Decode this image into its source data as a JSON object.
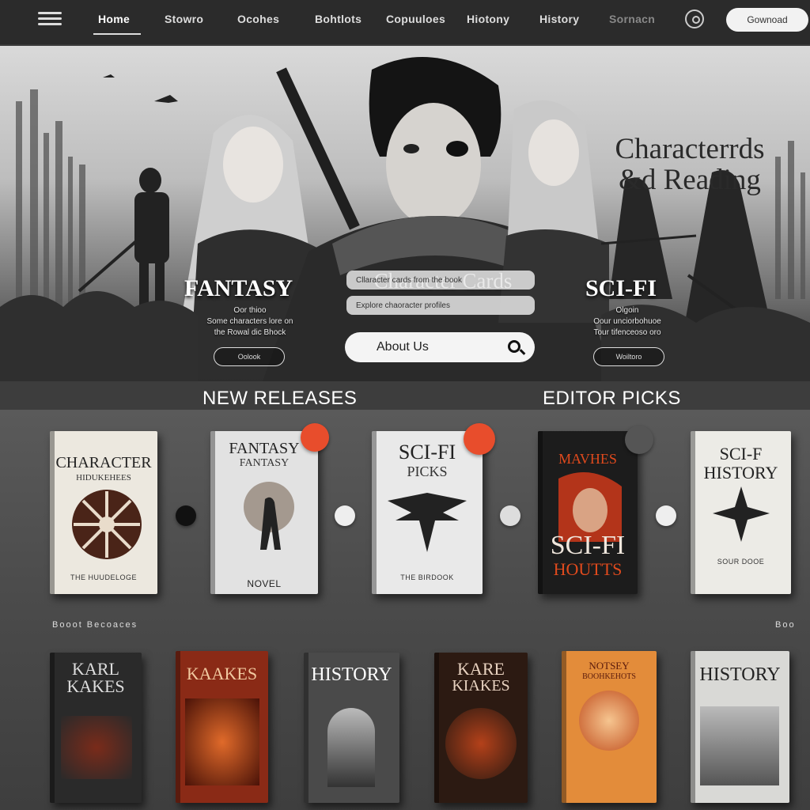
{
  "nav": {
    "items": [
      "Home",
      "Stowro",
      "Ocohes",
      "Bohtlots",
      "Copuuloes",
      "Hiotony",
      "History",
      "Sornacn"
    ],
    "download_label": "Gownoad"
  },
  "hero": {
    "title_line1": "Characterrds",
    "title_line2": "&d Reading",
    "card_title": "Character Cards",
    "pill1": "Cllaracter cards from the book",
    "pill2": "Explore chaoracter profiles",
    "search_text": "About Us",
    "left_genre": "FANTASY",
    "left_desc": "Oor thioo\nSome characters lore on\nthe Rowal dic Bhock",
    "left_btn": "Oolook",
    "right_genre": "SCI-FI",
    "right_desc": "Olgoin\nOour unciorbohuoe\nTour tifenceoso oro",
    "right_btn": "Woiltoro"
  },
  "sections": {
    "left": "NEW RELEASES",
    "right": "EDITOR PICKS",
    "row2_label": "Booot Becoaces",
    "row2_right": "Boo"
  },
  "row1": [
    {
      "title": "CHARACTER",
      "subtitle": "HIDUKEHEES",
      "footer": "THE HUUDELOGE",
      "bg": "#ece8df",
      "fg": "#222"
    },
    {
      "title": "FANTASY",
      "subtitle": "FANTASY",
      "footer": "NOVEL",
      "bg": "#e2e2e2",
      "fg": "#222"
    },
    {
      "title": "SCI-FI",
      "subtitle": "PICKS",
      "footer": "THE BIRDOOK",
      "bg": "#e9e9e9",
      "fg": "#222"
    },
    {
      "title": "SCI-FI",
      "subtitle": "MAVHES",
      "footer": "HOUTTS",
      "bg": "#1c1c1c",
      "fg": "#e04a1d"
    },
    {
      "title": "SCI-F",
      "subtitle": "HISTORY",
      "footer": "SOUR DOOE",
      "bg": "#ecebe6",
      "fg": "#222"
    }
  ],
  "row2": [
    {
      "title": "KARL",
      "subtitle": "KAKES",
      "bg": "#2a2a2a",
      "fg": "#ddd"
    },
    {
      "title": "KAAKES",
      "subtitle": "",
      "bg": "#8a2a16",
      "fg": "#f1c9a0"
    },
    {
      "title": "HISTORY",
      "subtitle": "",
      "bg": "#4a4a4a",
      "fg": "#fff"
    },
    {
      "title": "KARE",
      "subtitle": "KIAKES",
      "bg": "#2c1a12",
      "fg": "#e8d2c0"
    },
    {
      "title": "NOTSEY",
      "subtitle": "BOOHKEHOTS",
      "bg": "#e38c3a",
      "fg": "#5a1a0c"
    },
    {
      "title": "HISTORY",
      "subtitle": "",
      "bg": "#d9d9d6",
      "fg": "#222"
    }
  ],
  "colors": {
    "accent": "#e84d2c",
    "nav_bg": "#2b2b2b"
  }
}
